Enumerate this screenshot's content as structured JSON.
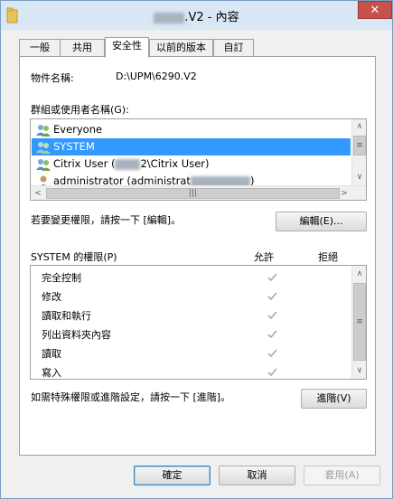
{
  "window": {
    "title_suffix": ".V2 - 內容",
    "close_label": "✕"
  },
  "tabs": [
    {
      "label": "一般"
    },
    {
      "label": "共用"
    },
    {
      "label": "安全性"
    },
    {
      "label": "以前的版本"
    },
    {
      "label": "自訂"
    }
  ],
  "security": {
    "object_name_label": "物件名稱:",
    "object_name_value": "D:\\UPM\\6290.V2",
    "group_list_label": "群組或使用者名稱(G):",
    "principals": [
      {
        "name": "Everyone",
        "icon": "users-group-icon",
        "selected": false
      },
      {
        "name": "SYSTEM",
        "icon": "users-group-icon",
        "selected": true
      },
      {
        "name_prefix": "Citrix User (",
        "name_suffix": "2\\Citrix User)",
        "icon": "users-group-icon",
        "selected": false
      },
      {
        "name_prefix": "administrator (administrat",
        "name_suffix": ")",
        "icon": "user-icon",
        "selected": false
      }
    ],
    "edit_hint": "若要變更權限，請按一下 [編輯]。",
    "edit_button": "編輯(E)...",
    "perm_header": "SYSTEM 的權限(P)",
    "allow_header": "允許",
    "deny_header": "拒絕",
    "permissions": [
      {
        "name": "完全控制",
        "allow": true
      },
      {
        "name": "修改",
        "allow": true
      },
      {
        "name": "讀取和執行",
        "allow": true
      },
      {
        "name": "列出資料夾內容",
        "allow": true
      },
      {
        "name": "讀取",
        "allow": true
      },
      {
        "name": "寫入",
        "allow": true
      }
    ],
    "advanced_hint": "如需特殊權限或進階設定，請按一下 [進階]。",
    "advanced_button": "進階(V)"
  },
  "footer": {
    "ok": "確定",
    "cancel": "取消",
    "apply": "套用(A)"
  }
}
